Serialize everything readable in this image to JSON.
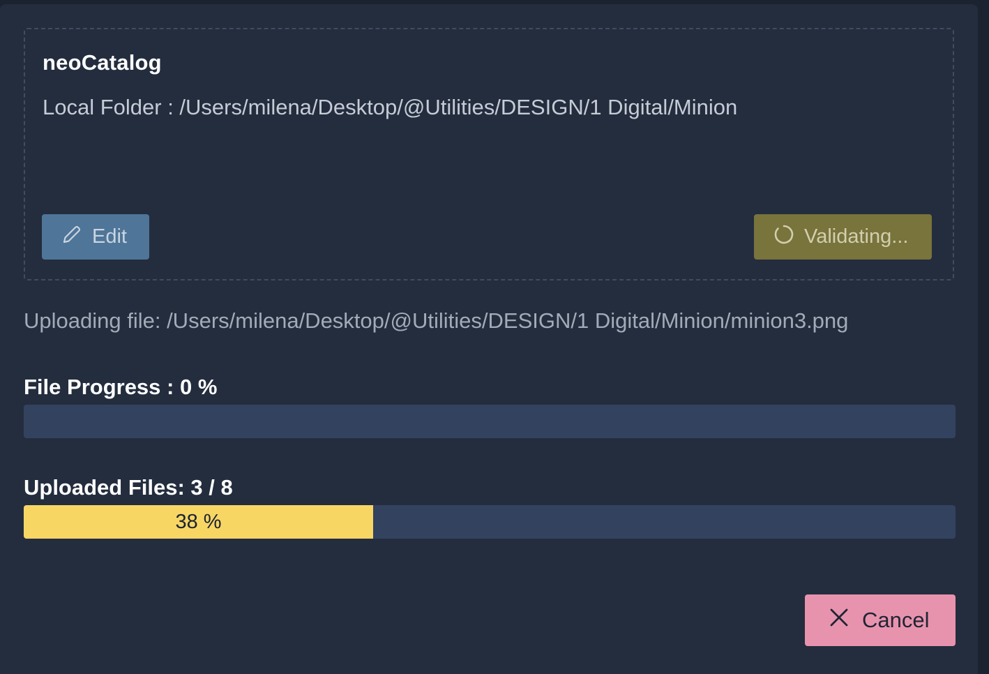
{
  "catalog": {
    "name": "neoCatalog",
    "local_folder_label": "Local Folder : /Users/milena/Desktop/@Utilities/DESIGN/1 Digital/Minion",
    "edit_label": "Edit",
    "validate_label": "Validating..."
  },
  "upload": {
    "current_file_label": "Uploading file: /Users/milena/Desktop/@Utilities/DESIGN/1 Digital/Minion/minion3.png",
    "file_progress_label": "File Progress : 0 %",
    "file_progress_value": 0,
    "uploaded_files_label": "Uploaded Files: 3 / 8",
    "uploaded_files_done": 3,
    "uploaded_files_total": 8,
    "uploaded_percent_label": "38 %"
  },
  "actions": {
    "cancel_label": "Cancel"
  },
  "icons": {
    "edit": "pencil-icon",
    "validate": "spinner-icon",
    "cancel": "close-icon"
  },
  "colors": {
    "background": "#232d3e",
    "edit_button": "#4f7598",
    "validate_button": "#79733c",
    "progress_track": "#33425f",
    "progress_fill": "#f8d664",
    "cancel_button": "#e893ae"
  }
}
